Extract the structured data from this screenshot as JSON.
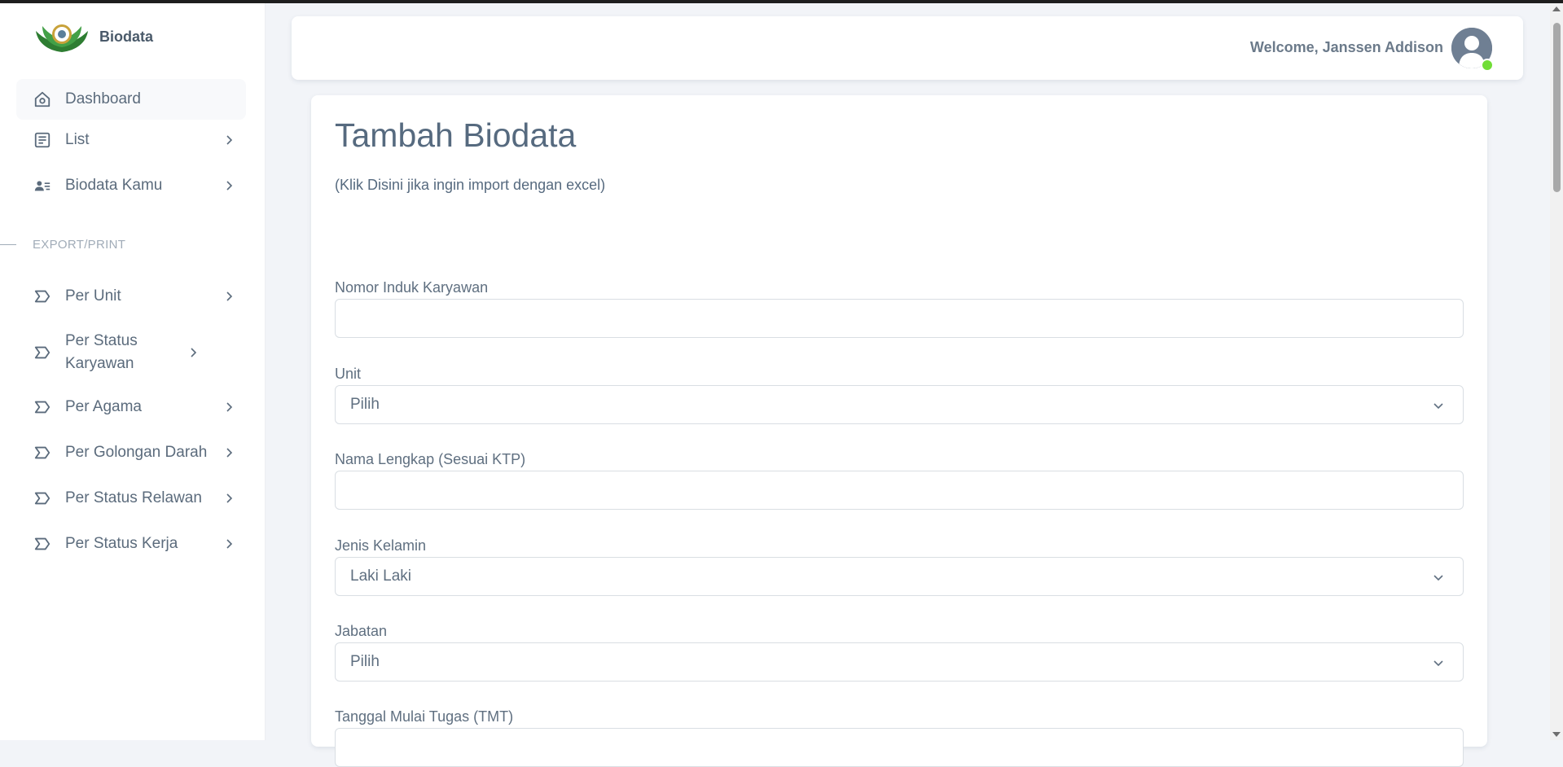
{
  "brand": {
    "name": "Biodata",
    "logo_icon": "lotus-emblem-logo"
  },
  "sidebar": {
    "items": [
      {
        "label": "Dashboard",
        "icon": "home-icon"
      },
      {
        "label": "List",
        "icon": "list-icon"
      },
      {
        "label": "Biodata Kamu",
        "icon": "user-detail-icon"
      }
    ],
    "section_title": "EXPORT/PRINT",
    "export_items": [
      {
        "label": "Per Unit",
        "icon": "sigma-icon"
      },
      {
        "label": "Per Status Karyawan",
        "icon": "sigma-icon"
      },
      {
        "label": "Per Agama",
        "icon": "sigma-icon"
      },
      {
        "label": "Per Golongan Darah",
        "icon": "sigma-icon"
      },
      {
        "label": "Per Status Relawan",
        "icon": "sigma-icon"
      },
      {
        "label": "Per Status Kerja",
        "icon": "sigma-icon"
      }
    ]
  },
  "header": {
    "welcome": "Welcome, Janssen Addison",
    "status_color": "#71dd37"
  },
  "form": {
    "title": "Tambah Biodata",
    "import_link": "(Klik Disini jika ingin import dengan excel)",
    "fields": [
      {
        "label": "Nomor Induk Karyawan",
        "type": "text",
        "value": ""
      },
      {
        "label": "Unit",
        "type": "select",
        "value": "Pilih"
      },
      {
        "label": "Nama Lengkap (Sesuai KTP)",
        "type": "text",
        "value": ""
      },
      {
        "label": "Jenis Kelamin",
        "type": "select",
        "value": "Laki Laki"
      },
      {
        "label": "Jabatan",
        "type": "select",
        "value": "Pilih"
      },
      {
        "label": "Tanggal Mulai Tugas (TMT)",
        "type": "date",
        "value": ""
      }
    ]
  }
}
